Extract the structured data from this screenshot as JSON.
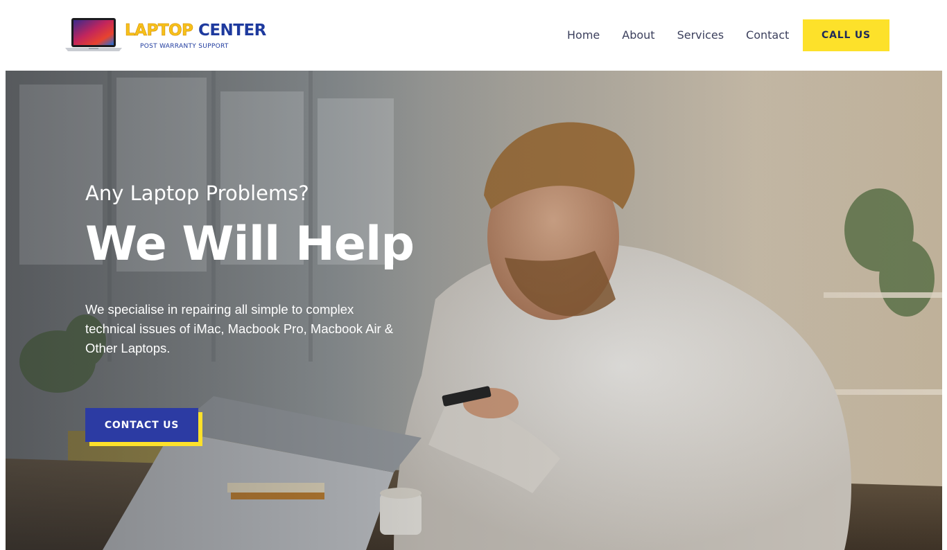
{
  "brand": {
    "title_part1": "LAPTOP",
    "title_part2": "CENTER",
    "subtitle": "POST WARRANTY SUPPORT"
  },
  "nav": {
    "items": [
      {
        "label": "Home"
      },
      {
        "label": "About"
      },
      {
        "label": "Services"
      },
      {
        "label": "Contact"
      }
    ],
    "call_button": "CALL US"
  },
  "hero": {
    "kicker": "Any Laptop Problems?",
    "title": "We Will Help",
    "description": "We specialise in repairing all simple to complex technical issues of iMac, Macbook Pro, Macbook Air & Other Laptops.",
    "cta_label": "CONTACT US"
  },
  "colors": {
    "accent_yellow": "#fde12a",
    "brand_blue": "#2c3ba3",
    "nav_text": "#3b3f5c"
  }
}
